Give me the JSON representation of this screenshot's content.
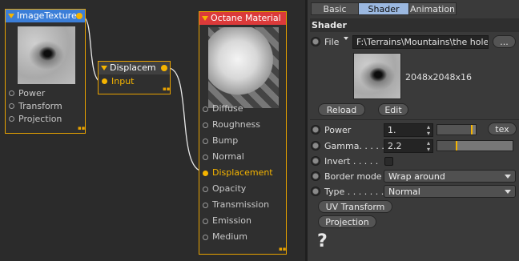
{
  "nodes": {
    "image_texture": {
      "title": "ImageTexture",
      "ports": [
        "Power",
        "Transform",
        "Projection"
      ]
    },
    "displacement": {
      "title": "Displacem",
      "ports": [
        "Input"
      ]
    },
    "octane_material": {
      "title": "Octane Material",
      "header_color": "#e03c3c",
      "ports": [
        "Diffuse",
        "Roughness",
        "Bump",
        "Normal",
        "Displacement",
        "Opacity",
        "Transmission",
        "Emission",
        "Medium"
      ]
    }
  },
  "accent_color": "#f5b400",
  "panel": {
    "tabs": [
      {
        "label": "Basic",
        "active": false
      },
      {
        "label": "Shader",
        "active": true
      },
      {
        "label": "Animation",
        "active": false
      }
    ],
    "section_title": "Shader",
    "file": {
      "label": "File",
      "path": "F:\\Terrains\\Mountains\\the hole",
      "browse_label": "...",
      "resolution": "2048x2048x16"
    },
    "reload_label": "Reload",
    "edit_label": "Edit",
    "power": {
      "label": "Power",
      "value": "1.",
      "tex_label": "tex",
      "level": 0.9
    },
    "gamma": {
      "label": "Gamma. . . . .",
      "value": "2.2",
      "level": 0.25
    },
    "invert": {
      "label": "Invert . . . . .",
      "checked": false
    },
    "border_mode": {
      "label": "Border mode",
      "value": "Wrap around"
    },
    "type": {
      "label": "Type . . . . . . .",
      "value": "Normal"
    },
    "uv_transform_label": "UV Transform",
    "projection_label": "Projection",
    "help_glyph": "?"
  }
}
